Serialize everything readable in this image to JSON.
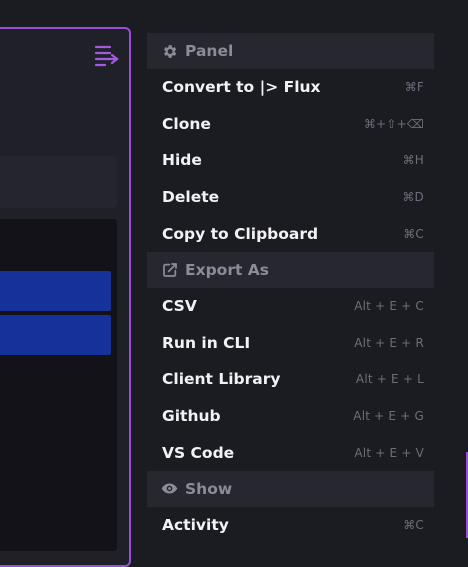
{
  "menu": {
    "panel_section": {
      "label": "Panel",
      "icon": "gear-icon",
      "items": [
        {
          "label": "Convert to |> Flux",
          "shortcut": "⌘F"
        },
        {
          "label": "Clone",
          "shortcut": "⌘+⇧+⌫"
        },
        {
          "label": "Hide",
          "shortcut": "⌘H"
        },
        {
          "label": "Delete",
          "shortcut": "⌘D"
        },
        {
          "label": "Copy to Clipboard",
          "shortcut": "⌘C"
        }
      ]
    },
    "export_section": {
      "label": "Export As",
      "icon": "export-icon",
      "items": [
        {
          "label": "CSV",
          "shortcut": "Alt + E + C"
        },
        {
          "label": "Run in CLI",
          "shortcut": "Alt + E + R"
        },
        {
          "label": "Client Library",
          "shortcut": "Alt + E + L"
        },
        {
          "label": "Github",
          "shortcut": "Alt + E + G"
        },
        {
          "label": "VS Code",
          "shortcut": "Alt + E + V"
        }
      ]
    },
    "show_section": {
      "label": "Show",
      "icon": "eye-icon",
      "items": [
        {
          "label": "Activity",
          "shortcut": "⌘C"
        }
      ]
    }
  },
  "colors": {
    "accent": "#9b4fd6",
    "bar": "#15329a",
    "background": "#1b1b22",
    "section_header_bg": "#27272f"
  }
}
